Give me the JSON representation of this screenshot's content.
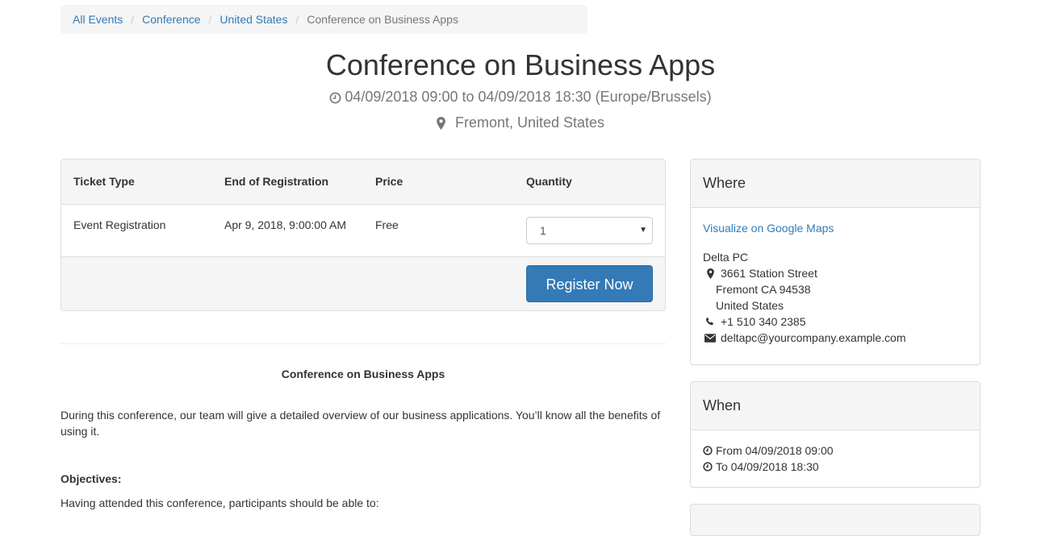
{
  "breadcrumb": {
    "items": [
      "All Events",
      "Conference",
      "United States"
    ],
    "current": "Conference on Business Apps"
  },
  "event": {
    "title": "Conference on Business Apps",
    "dates": "04/09/2018 09:00 to 04/09/2018 18:30 (Europe/Brussels)",
    "location": "Fremont, United States"
  },
  "tickets": {
    "headers": [
      "Ticket Type",
      "End of Registration",
      "Price",
      "Quantity"
    ],
    "rows": [
      {
        "type": "Event Registration",
        "end": "Apr 9, 2018, 9:00:00 AM",
        "price": "Free",
        "quantity": "1"
      }
    ],
    "register_label": "Register Now"
  },
  "description": {
    "title": "Conference on Business Apps",
    "body": "During this conference, our team will give a detailed overview of our business applications. You’ll know all the benefits of using it.",
    "objectives_title": "Objectives:",
    "objectives_intro": "Having attended this conference, participants should be able to:"
  },
  "where": {
    "title": "Where",
    "map_link": "Visualize on Google Maps",
    "name": "Delta PC",
    "street": "3661 Station Street",
    "city": "Fremont CA 94538",
    "country": "United States",
    "phone": "+1 510 340 2385",
    "email": "deltapc@yourcompany.example.com"
  },
  "when": {
    "title": "When",
    "from": "From 04/09/2018 09:00",
    "to": "To 04/09/2018 18:30"
  },
  "colors": {
    "link": "#337ab7",
    "primary_button": "#337ab7",
    "panel_heading": "#f5f5f5",
    "muted_text": "#777777"
  },
  "icons": {
    "clock": "clock-icon",
    "map_marker": "map-marker-icon",
    "phone": "phone-icon",
    "envelope": "envelope-icon"
  }
}
